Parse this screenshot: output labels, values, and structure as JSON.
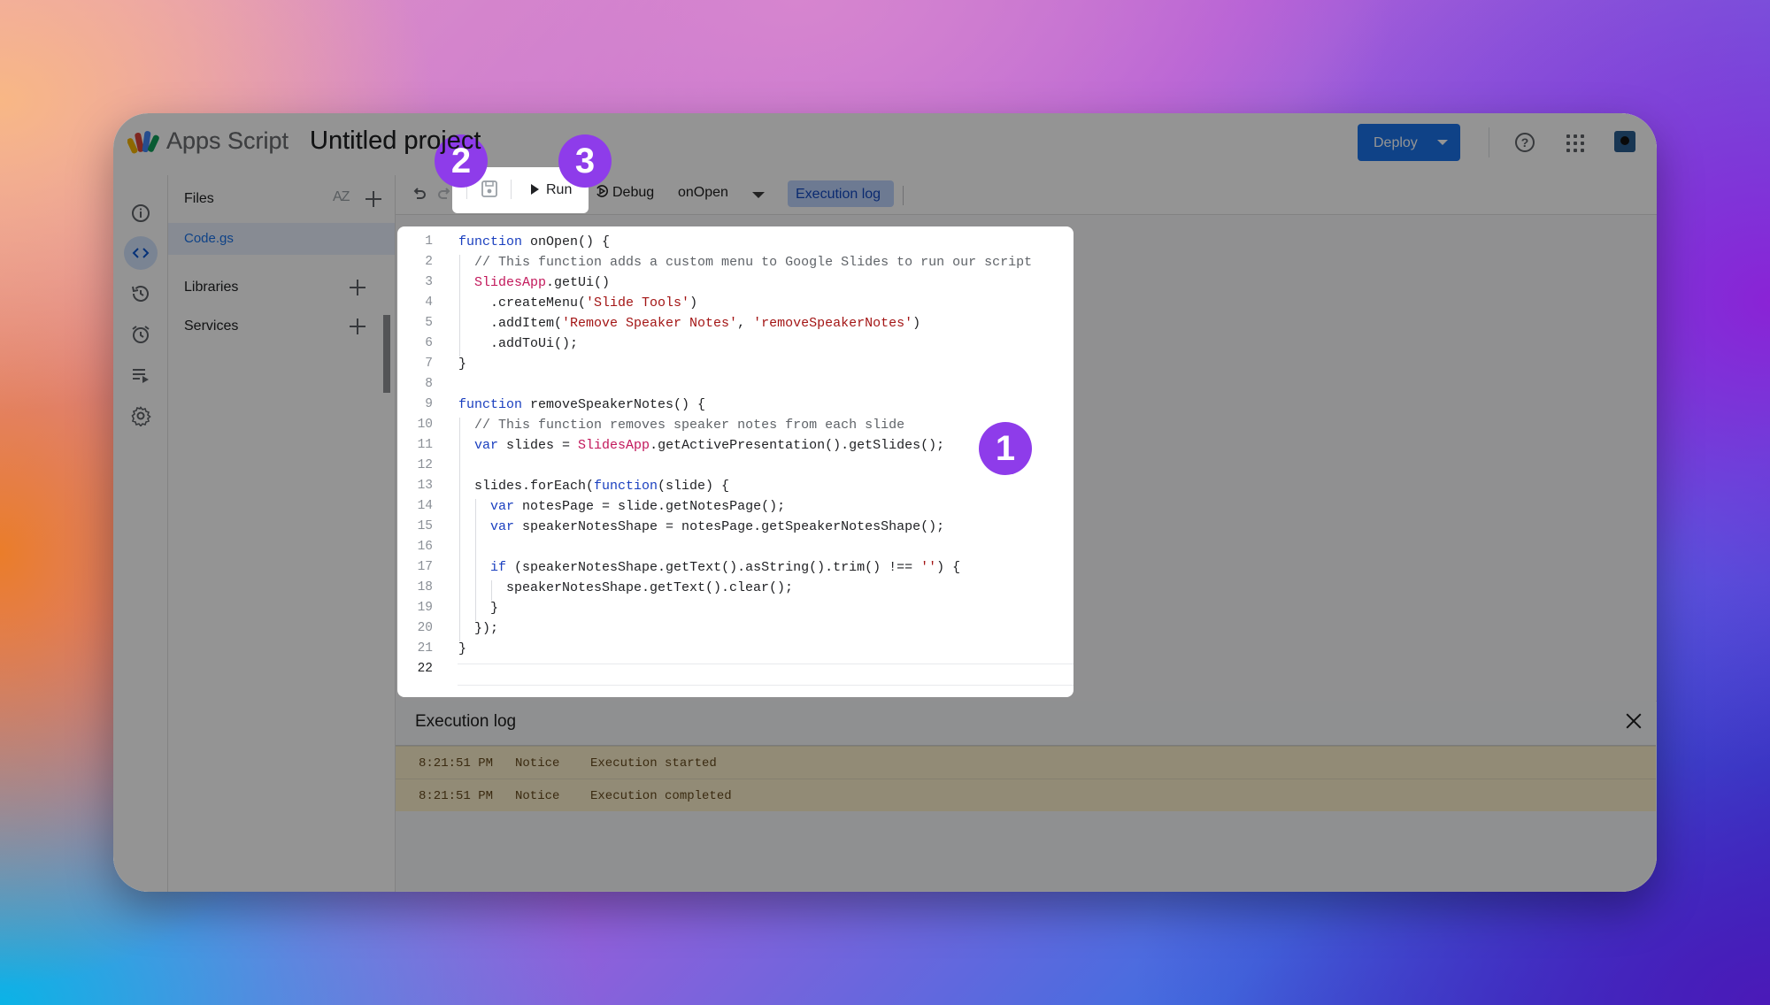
{
  "app": {
    "name": "Apps Script",
    "project_title": "Untitled project"
  },
  "header": {
    "deploy_label": "Deploy"
  },
  "rail": {
    "items": [
      "overview-icon",
      "editor-icon",
      "triggers-history-icon",
      "triggers-icon",
      "executions-icon",
      "settings-icon"
    ],
    "active": "editor-icon"
  },
  "files": {
    "header": "Files",
    "sort_label": "AZ",
    "items": [
      {
        "name": "Code.gs"
      }
    ],
    "sections": [
      {
        "label": "Libraries"
      },
      {
        "label": "Services"
      }
    ]
  },
  "toolbar": {
    "run_label": "Run",
    "debug_label": "Debug",
    "function_selected": "onOpen",
    "execution_log_label": "Execution log"
  },
  "editor": {
    "lines": [
      "function onOpen() {",
      "  // This function adds a custom menu to Google Slides to run our script",
      "  SlidesApp.getUi()",
      "    .createMenu('Slide Tools')",
      "    .addItem('Remove Speaker Notes', 'removeSpeakerNotes')",
      "    .addToUi();",
      "}",
      "",
      "function removeSpeakerNotes() {",
      "  // This function removes speaker notes from each slide",
      "  var slides = SlidesApp.getActivePresentation().getSlides();",
      "",
      "  slides.forEach(function(slide) {",
      "    var notesPage = slide.getNotesPage();",
      "    var speakerNotesShape = notesPage.getSpeakerNotesShape();",
      "",
      "    if (speakerNotesShape.getText().asString().trim() !== '') {",
      "      speakerNotesShape.getText().clear();",
      "    }",
      "  });",
      "}",
      ""
    ],
    "current_line": 22
  },
  "execution_log": {
    "title": "Execution log",
    "entries": [
      {
        "time": "8:21:51 PM",
        "level": "Notice",
        "message": "Execution started"
      },
      {
        "time": "8:21:51 PM",
        "level": "Notice",
        "message": "Execution completed"
      }
    ]
  },
  "badges": [
    "1",
    "2",
    "3"
  ],
  "colors": {
    "accent": "#1a73e8",
    "badge": "#8e3cea",
    "log_row": "#fef7e0"
  }
}
